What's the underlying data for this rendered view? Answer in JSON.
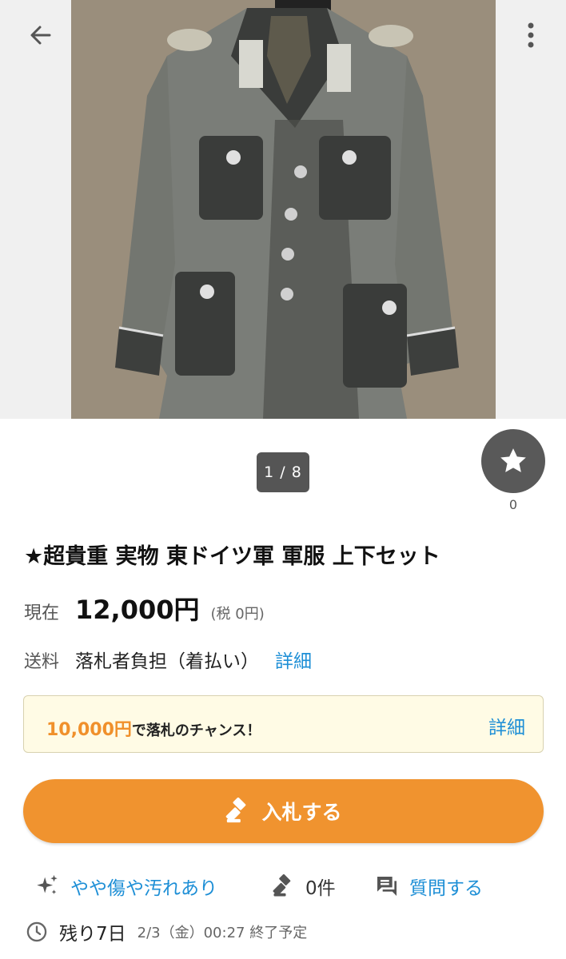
{
  "gallery": {
    "counter": "1 / 8",
    "back_icon": "arrow-left-icon",
    "more_icon": "more-vertical-icon",
    "favorite_icon": "star-icon",
    "favorite_count": "0"
  },
  "item": {
    "title": "★超貴重 実物 東ドイツ軍 軍服 上下セット",
    "price_label": "現在",
    "price": "12,000円",
    "tax": "(税 0円)",
    "shipping_label": "送料",
    "shipping": "落札者負担（着払い）",
    "shipping_detail_link": "詳細"
  },
  "promo": {
    "amount": "10,000円",
    "text": "で落札のチャンス！",
    "detail_link": "詳細"
  },
  "bid_button": {
    "label": "入札する",
    "icon": "gavel-icon"
  },
  "meta": {
    "condition": "やや傷や汚れあり",
    "condition_icon": "sparkle-icon",
    "bids": "0件",
    "bids_icon": "gavel-icon",
    "question": "質問する",
    "question_icon": "chat-icon"
  },
  "end": {
    "remaining": "残り7日",
    "date": "2/3（金）00:27 終了予定",
    "icon": "clock-icon"
  },
  "colors": {
    "accent_orange": "#f0932f",
    "link_blue": "#1e8fd6",
    "promo_bg": "#fffbe5"
  }
}
